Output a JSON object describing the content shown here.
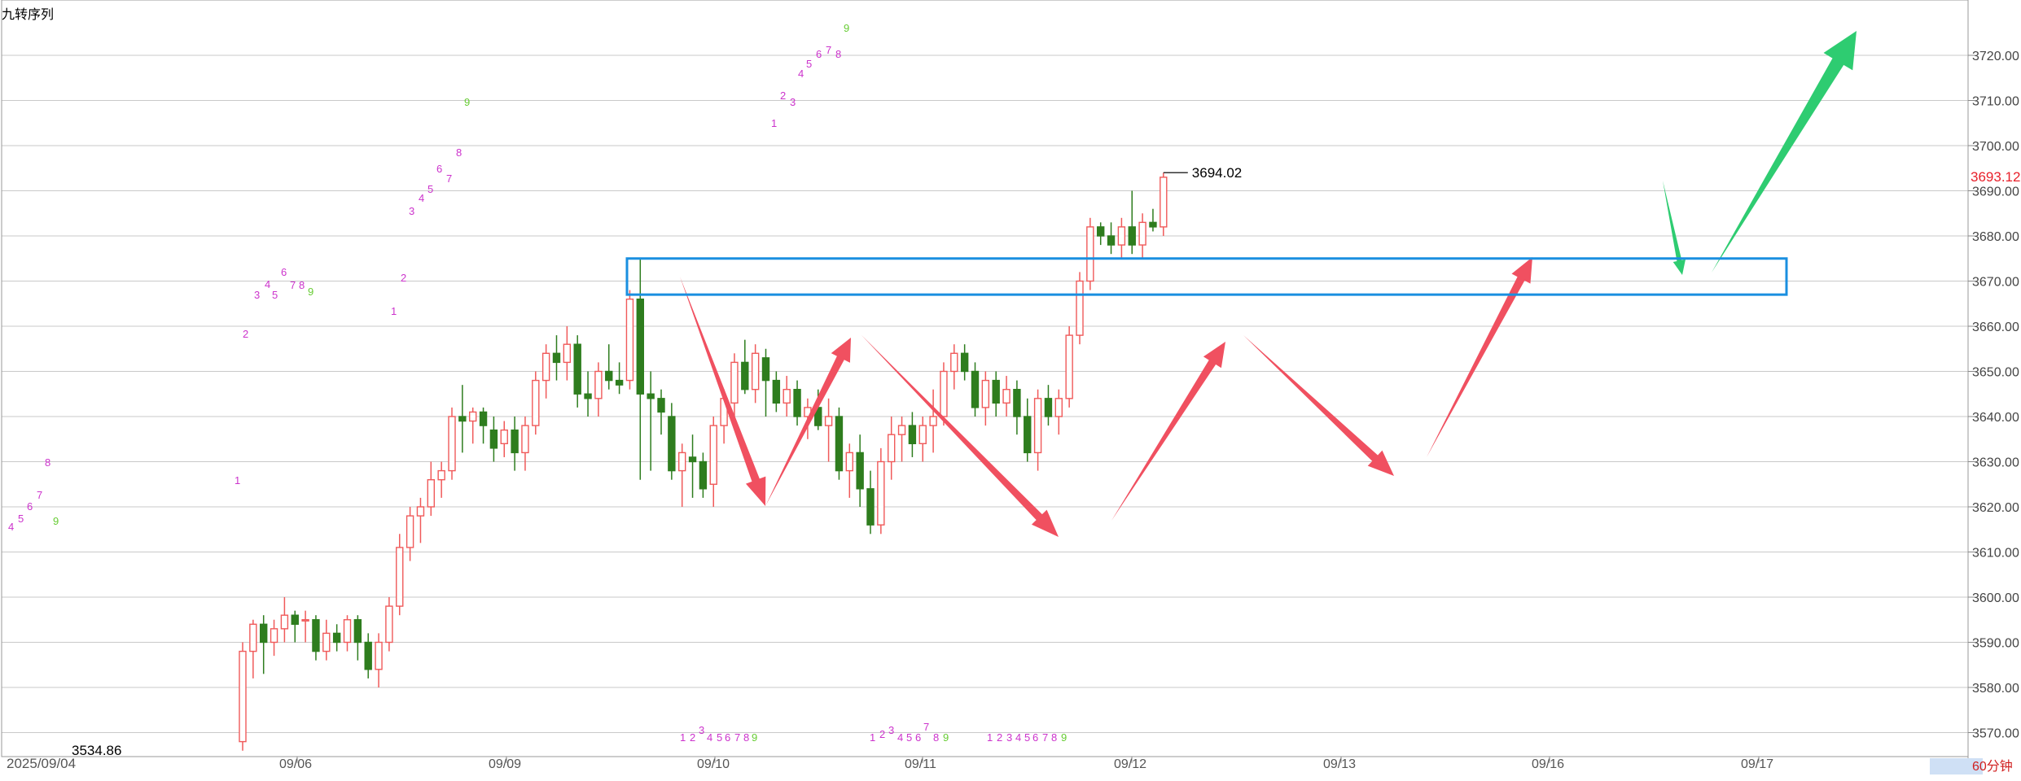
{
  "header": {
    "indicator_label": "九转序列"
  },
  "right_axis": {
    "current_price_label": "3693.12",
    "current_price_color": "#e8202a"
  },
  "bottom_right_label": "60分钟",
  "annotations": {
    "callout_price": "3694.02",
    "low_label": "3534.86",
    "start_date_label": "2025/09/04"
  },
  "colors": {
    "up_candle": "#f05a5a",
    "down_candle": "#2e7d1e",
    "td_up": "#cc33cc",
    "td_complete": "#66cc33",
    "bear_arrow": "#f05060",
    "bull_arrow": "#2ecc71",
    "box": "#1a8fe0",
    "grid": "#c9c9c9"
  },
  "chart_data": {
    "type": "candlestick",
    "title": "",
    "xlabel": "",
    "ylabel": "",
    "y_ticks": [
      3570,
      3580,
      3590,
      3600,
      3610,
      3620,
      3630,
      3640,
      3650,
      3660,
      3670,
      3680,
      3690,
      3700,
      3710,
      3720
    ],
    "ylim": [
      3566,
      3730
    ],
    "x_ticks": [
      "2025/09/04",
      "09/06",
      "09/09",
      "09/10",
      "09/11",
      "09/12",
      "09/13",
      "09/16",
      "09/17"
    ],
    "candles_ohlc": [
      [
        3568,
        3590,
        3566,
        3588
      ],
      [
        3588,
        3595,
        3582,
        3594
      ],
      [
        3594,
        3596,
        3583,
        3590
      ],
      [
        3590,
        3595,
        3587,
        3593
      ],
      [
        3593,
        3600,
        3590,
        3596
      ],
      [
        3596,
        3597,
        3590,
        3594
      ],
      [
        3595,
        3597,
        3590,
        3595
      ],
      [
        3595,
        3596,
        3586,
        3588
      ],
      [
        3588,
        3595,
        3586,
        3592
      ],
      [
        3592,
        3594,
        3588,
        3590
      ],
      [
        3590,
        3596,
        3588,
        3595
      ],
      [
        3595,
        3596,
        3586,
        3590
      ],
      [
        3590,
        3592,
        3582,
        3584
      ],
      [
        3584,
        3592,
        3580,
        3590
      ],
      [
        3590,
        3600,
        3588,
        3598
      ],
      [
        3598,
        3614,
        3596,
        3611
      ],
      [
        3611,
        3620,
        3608,
        3618
      ],
      [
        3618,
        3622,
        3612,
        3620
      ],
      [
        3620,
        3630,
        3618,
        3626
      ],
      [
        3626,
        3630,
        3622,
        3628
      ],
      [
        3628,
        3642,
        3626,
        3640
      ],
      [
        3640,
        3647,
        3632,
        3639
      ],
      [
        3639,
        3642,
        3634,
        3641
      ],
      [
        3641,
        3642,
        3634,
        3638
      ],
      [
        3637,
        3640,
        3630,
        3633
      ],
      [
        3634,
        3639,
        3631,
        3637
      ],
      [
        3637,
        3640,
        3628,
        3632
      ],
      [
        3632,
        3640,
        3628,
        3638
      ],
      [
        3638,
        3650,
        3636,
        3648
      ],
      [
        3648,
        3656,
        3644,
        3654
      ],
      [
        3654,
        3658,
        3648,
        3652
      ],
      [
        3652,
        3660,
        3648,
        3656
      ],
      [
        3656,
        3658,
        3642,
        3645
      ],
      [
        3645,
        3650,
        3640,
        3644
      ],
      [
        3644,
        3652,
        3640,
        3650
      ],
      [
        3650,
        3656,
        3646,
        3648
      ],
      [
        3648,
        3652,
        3645,
        3647
      ],
      [
        3648,
        3668,
        3646,
        3666
      ],
      [
        3666,
        3675,
        3626,
        3645
      ],
      [
        3645,
        3650,
        3628,
        3644
      ],
      [
        3644,
        3646,
        3636,
        3641
      ],
      [
        3640,
        3643,
        3626,
        3628
      ],
      [
        3628,
        3634,
        3620,
        3632
      ],
      [
        3631,
        3636,
        3622,
        3630
      ],
      [
        3630,
        3632,
        3622,
        3624
      ],
      [
        3625,
        3640,
        3620,
        3638
      ],
      [
        3638,
        3646,
        3634,
        3644
      ],
      [
        3643,
        3654,
        3640,
        3652
      ],
      [
        3652,
        3657,
        3645,
        3646
      ],
      [
        3646,
        3656,
        3643,
        3654
      ],
      [
        3653,
        3655,
        3640,
        3648
      ],
      [
        3648,
        3650,
        3641,
        3643
      ],
      [
        3643,
        3649,
        3640,
        3646
      ],
      [
        3646,
        3648,
        3638,
        3640
      ],
      [
        3640,
        3644,
        3635,
        3642
      ],
      [
        3642,
        3646,
        3637,
        3638
      ],
      [
        3638,
        3644,
        3630,
        3640
      ],
      [
        3640,
        3642,
        3626,
        3628
      ],
      [
        3628,
        3634,
        3622,
        3632
      ],
      [
        3632,
        3636,
        3620,
        3624
      ],
      [
        3624,
        3628,
        3614,
        3616
      ],
      [
        3616,
        3633,
        3614,
        3630
      ],
      [
        3630,
        3640,
        3626,
        3636
      ],
      [
        3636,
        3640,
        3630,
        3638
      ],
      [
        3638,
        3641,
        3631,
        3634
      ],
      [
        3634,
        3640,
        3630,
        3638
      ],
      [
        3638,
        3646,
        3632,
        3640
      ],
      [
        3640,
        3652,
        3638,
        3650
      ],
      [
        3650,
        3656,
        3646,
        3654
      ],
      [
        3654,
        3656,
        3648,
        3650
      ],
      [
        3650,
        3652,
        3640,
        3642
      ],
      [
        3642,
        3650,
        3638,
        3648
      ],
      [
        3648,
        3650,
        3640,
        3643
      ],
      [
        3643,
        3649,
        3640,
        3646
      ],
      [
        3646,
        3648,
        3636,
        3640
      ],
      [
        3640,
        3644,
        3630,
        3632
      ],
      [
        3632,
        3646,
        3628,
        3644
      ],
      [
        3644,
        3647,
        3638,
        3640
      ],
      [
        3640,
        3646,
        3636,
        3644
      ],
      [
        3644,
        3660,
        3642,
        3658
      ],
      [
        3658,
        3672,
        3656,
        3670
      ],
      [
        3670,
        3684,
        3668,
        3682
      ],
      [
        3682,
        3683,
        3678,
        3680
      ],
      [
        3680,
        3683,
        3676,
        3678
      ],
      [
        3678,
        3684,
        3675,
        3682
      ],
      [
        3682,
        3690,
        3676,
        3678
      ],
      [
        3678,
        3685,
        3675,
        3683
      ],
      [
        3683,
        3686,
        3681,
        3682
      ],
      [
        3682,
        3694,
        3680,
        3693
      ]
    ],
    "annotations": [
      {
        "text": "3694.02",
        "x_index": 88,
        "y": 3694.02
      },
      {
        "text": "3534.86",
        "x_index": 0,
        "y": 3534.86
      }
    ],
    "resistance_box": {
      "y_low": 3667,
      "y_high": 3675
    }
  }
}
